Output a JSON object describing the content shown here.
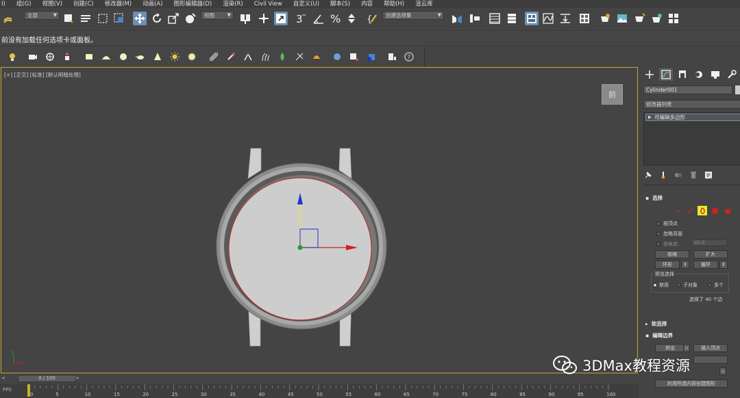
{
  "menu": {
    "items": [
      "I)",
      "组(G)",
      "视图(V)",
      "创建(C)",
      "修改器(M)",
      "动画(A)",
      "图形编辑器(D)",
      "渲染(R)",
      "Civil View",
      "自定义(U)",
      "脚本(S)",
      "内容",
      "帮助(H)",
      "渲云库"
    ]
  },
  "toolbar": {
    "selection_filter": "全部",
    "ref_coord": "视图",
    "named_selection": "创建选择集",
    "snap_label": "3",
    "angle_snap_label": "2",
    "percent_label": "%"
  },
  "ribbon": {
    "message": "前没有加载任何选项卡或面板。"
  },
  "viewport": {
    "label": "[+] [正交] [标准] [默认明暗处理]",
    "viewcube_label": "前",
    "axis_tripod": {
      "x": "x",
      "y": "y",
      "z": "z"
    }
  },
  "command_panel": {
    "object_name": "Cylinder001",
    "object_color": "#cccccc",
    "modifier_list_label": "修改器列表",
    "stack_item": "可编辑多边形",
    "selection_rollout": {
      "title": "选择",
      "active_subobject": "polygon-border",
      "by_vertex": "按顶点",
      "ignore_backfacing": "忽略背面",
      "by_angle_label": "按角度:",
      "by_angle_value": "45.0",
      "shrink": "收缩",
      "grow": "扩大",
      "ring": "环形",
      "loop": "循环",
      "preview_title": "预览选择",
      "preview_off": "禁用",
      "preview_subobj": "子对象",
      "preview_multi": "多个",
      "status": "选择了 40 个边"
    },
    "soft_selection_title": "软选择",
    "edit_borders": {
      "title": "编辑边界",
      "extrude": "挤出",
      "insert_vertex": "插入顶点",
      "create_shape": "利用所选内容创建图形"
    }
  },
  "timeline": {
    "position_label": "0 / 100",
    "prev": "<",
    "next": ">",
    "fps_label": "FPS",
    "ticks": [
      "0",
      "5",
      "10",
      "15",
      "20",
      "25",
      "30",
      "35",
      "40",
      "45",
      "50",
      "55",
      "60",
      "65",
      "70",
      "75",
      "80",
      "85",
      "90",
      "95",
      "100"
    ]
  },
  "watermark": {
    "text": "3DMax教程资源"
  },
  "colors": {
    "viewport_border": "#c8a437",
    "selection_active": "#e8e829",
    "axis_x": "#d02020",
    "axis_y": "#2a9a2a",
    "axis_z": "#1f35c8",
    "highlight_edge": "#c01818"
  }
}
